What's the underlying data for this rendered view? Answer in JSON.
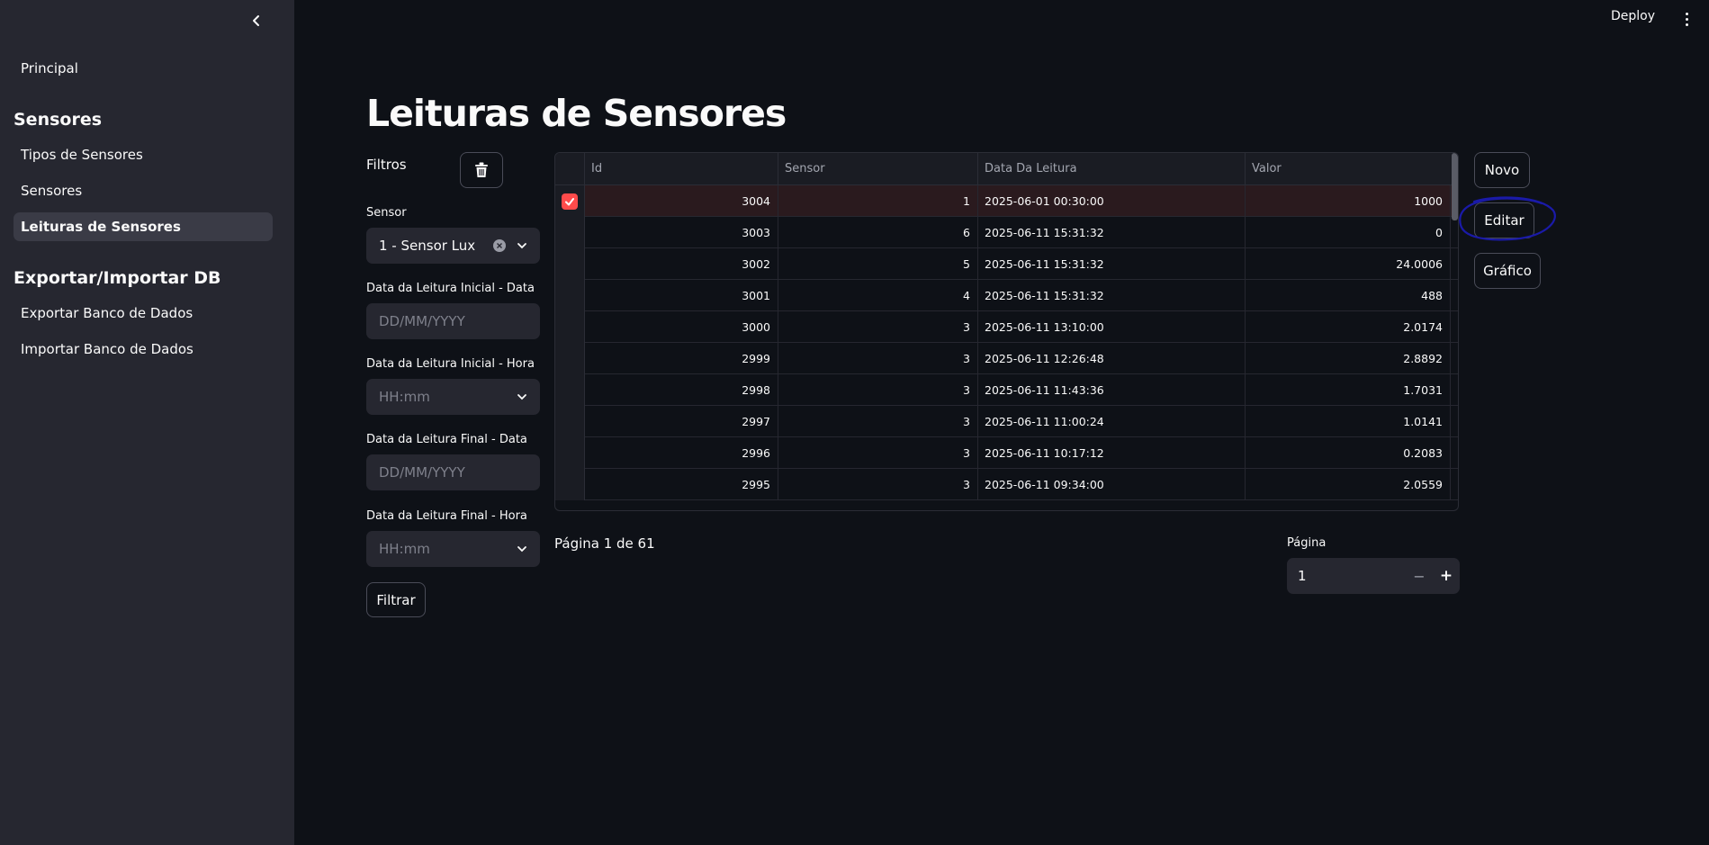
{
  "header": {
    "deploy_label": "Deploy"
  },
  "sidebar": {
    "principal": "Principal",
    "section_sensores": "Sensores",
    "items_sensores": [
      {
        "label": "Tipos de Sensores"
      },
      {
        "label": "Sensores"
      },
      {
        "label": "Leituras de Sensores"
      }
    ],
    "section_exportar": "Exportar/Importar DB",
    "items_exportar": [
      {
        "label": "Exportar Banco de Dados"
      },
      {
        "label": "Importar Banco de Dados"
      }
    ]
  },
  "main": {
    "title": "Leituras de Sensores",
    "filters": {
      "heading": "Filtros",
      "sensor_label": "Sensor",
      "sensor_value": "1 - Sensor Lux",
      "inicial_data_label": "Data da Leitura Inicial - Data",
      "inicial_data_placeholder": "DD/MM/YYYY",
      "inicial_hora_label": "Data da Leitura Inicial - Hora",
      "inicial_hora_placeholder": "HH:mm",
      "final_data_label": "Data da Leitura Final - Data",
      "final_data_placeholder": "DD/MM/YYYY",
      "final_hora_label": "Data da Leitura Final - Hora",
      "final_hora_placeholder": "HH:mm",
      "filtrar_label": "Filtrar"
    },
    "table": {
      "columns": [
        "Id",
        "Sensor",
        "Data Da Leitura",
        "Valor"
      ],
      "rows": [
        [
          "3004",
          "1",
          "2025-06-01 00:30:00",
          "1000"
        ],
        [
          "3003",
          "6",
          "2025-06-11 15:31:32",
          "0"
        ],
        [
          "3002",
          "5",
          "2025-06-11 15:31:32",
          "24.0006"
        ],
        [
          "3001",
          "4",
          "2025-06-11 15:31:32",
          "488"
        ],
        [
          "3000",
          "3",
          "2025-06-11 13:10:00",
          "2.0174"
        ],
        [
          "2999",
          "3",
          "2025-06-11 12:26:48",
          "2.8892"
        ],
        [
          "2998",
          "3",
          "2025-06-11 11:43:36",
          "1.7031"
        ],
        [
          "2997",
          "3",
          "2025-06-11 11:00:24",
          "1.0141"
        ],
        [
          "2996",
          "3",
          "2025-06-11 10:17:12",
          "0.2083"
        ],
        [
          "2995",
          "3",
          "2025-06-11 09:34:00",
          "2.0559"
        ]
      ]
    },
    "actions": {
      "novo": "Novo",
      "editar": "Editar",
      "grafico": "Gráfico"
    },
    "pagination": {
      "info": "Página 1 de 61",
      "label": "Página",
      "value": "1",
      "minus": "−",
      "plus": "+"
    },
    "colors": {
      "accent": "#ff4b4b",
      "annotation_circle": "#1a1aa8"
    }
  }
}
